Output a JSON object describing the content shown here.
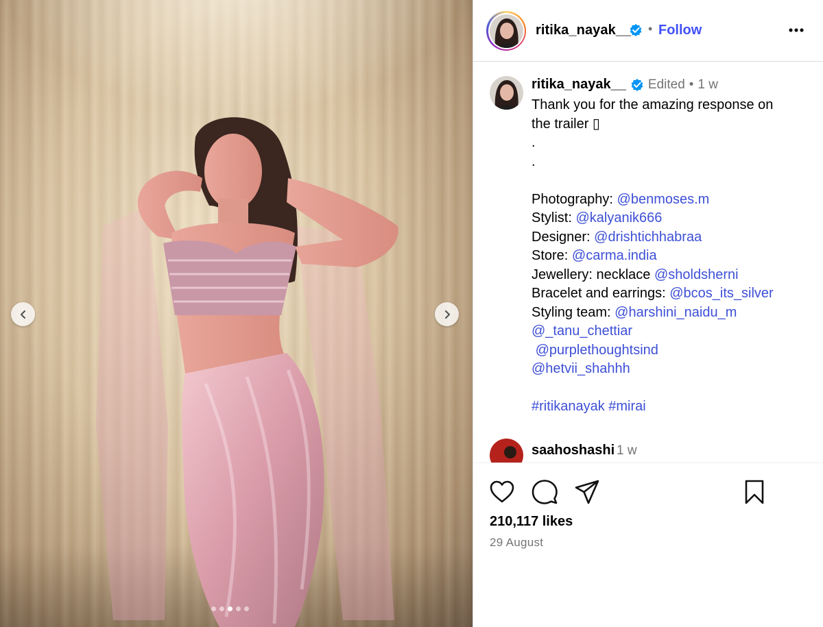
{
  "media": {
    "carousel": {
      "total_slides": 5,
      "active_slide": 3
    },
    "prev_icon": "chevron-left-icon",
    "next_icon": "chevron-right-icon"
  },
  "header": {
    "username": "ritika_nayak__",
    "separator": "•",
    "follow_label": "Follow",
    "more_icon": "more-horizontal-icon",
    "verified_icon": "verified-badge-icon"
  },
  "caption": {
    "username": "ritika_nayak__",
    "edited": "Edited",
    "dot": "•",
    "time": "1 w",
    "lines": [
      {
        "text": "Thank you for the amazing response on",
        "mention": ""
      },
      {
        "text": "the trailer ▯",
        "mention": ""
      },
      {
        "text": ".",
        "mention": ""
      },
      {
        "text": ".",
        "mention": ""
      },
      {
        "text": "",
        "mention": ""
      },
      {
        "text": "Photography: ",
        "mention": "@benmoses.m"
      },
      {
        "text": "Stylist: ",
        "mention": "@kalyanik666"
      },
      {
        "text": "Designer: ",
        "mention": "@drishtichhabraa"
      },
      {
        "text": "Store: ",
        "mention": "@carma.india"
      },
      {
        "text": "Jewellery: necklace ",
        "mention": "@sholdsherni"
      },
      {
        "text": "Bracelet and earrings: ",
        "mention": "@bcos_its_silver"
      },
      {
        "text": "Styling team: ",
        "mention": "@harshini_naidu_m"
      },
      {
        "text": "",
        "mention": "@_tanu_chettiar"
      },
      {
        "text": " ",
        "mention": "@purplethoughtsind"
      },
      {
        "text": "",
        "mention": "@hetvii_shahhh"
      },
      {
        "text": "",
        "mention": ""
      },
      {
        "text": "",
        "mention": "#ritikanayak #mirai"
      }
    ]
  },
  "comment": {
    "username": "saahoshashi",
    "time": "1 w"
  },
  "actions": {
    "like_icon": "heart-icon",
    "comment_icon": "comment-icon",
    "share_icon": "share-icon",
    "save_icon": "bookmark-icon"
  },
  "likes": "210,117 likes",
  "date": "29 August",
  "colors": {
    "follow": "#4150f7",
    "mention": "#3d4fd6",
    "verified": "#0095f6",
    "muted": "#737373",
    "border": "#dbdbdb"
  }
}
